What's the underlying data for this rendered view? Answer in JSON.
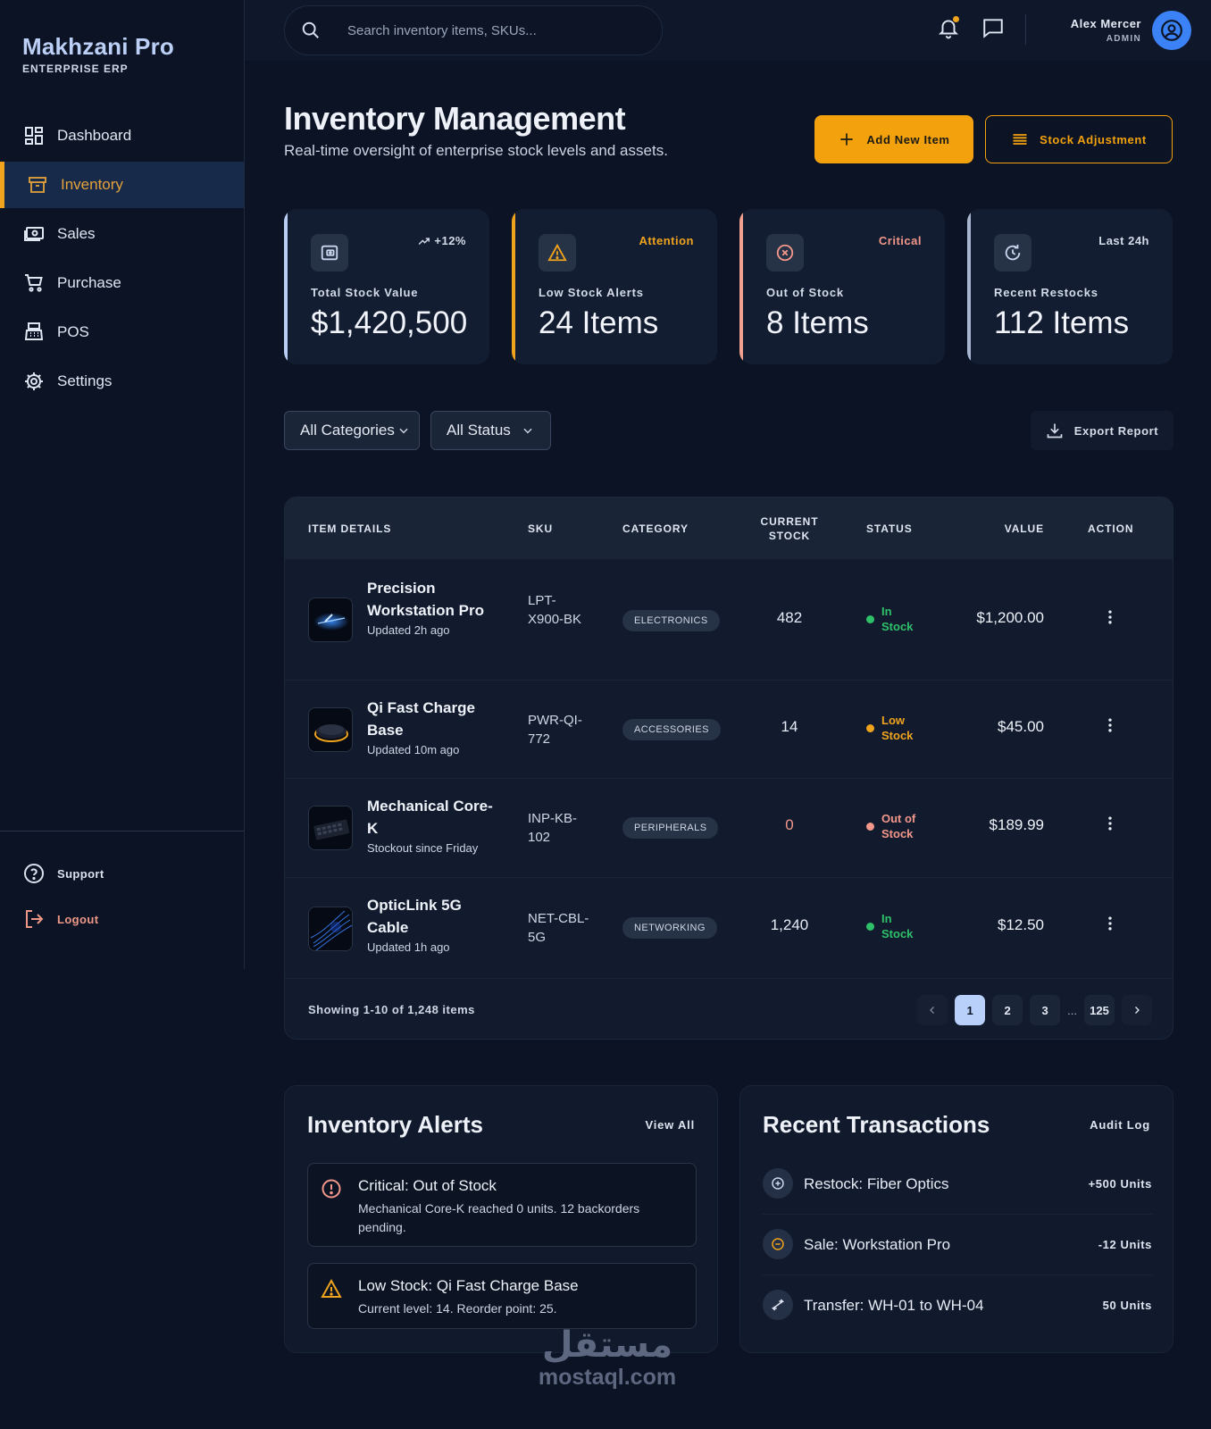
{
  "brand": {
    "name": "Makhzani Pro",
    "subtitle": "ENTERPRISE ERP"
  },
  "nav": {
    "items": [
      {
        "label": "Dashboard",
        "icon": "dashboard-icon",
        "active": false
      },
      {
        "label": "Inventory",
        "icon": "inventory-icon",
        "active": true
      },
      {
        "label": "Sales",
        "icon": "cash-icon",
        "active": false
      },
      {
        "label": "Purchase",
        "icon": "cart-icon",
        "active": false
      },
      {
        "label": "POS",
        "icon": "pos-icon",
        "active": false
      },
      {
        "label": "Settings",
        "icon": "gear-icon",
        "active": false
      }
    ],
    "support_label": "Support",
    "logout_label": "Logout"
  },
  "topbar": {
    "search_placeholder": "Search inventory items, SKUs...",
    "user_name": "Alex Mercer",
    "user_role": "ADMIN"
  },
  "header": {
    "title": "Inventory Management",
    "subtitle": "Real-time oversight of enterprise stock levels and assets.",
    "add_label": "Add New Item",
    "adjust_label": "Stock Adjustment"
  },
  "stats": [
    {
      "label": "Total Stock Value",
      "value": "$1,420,500",
      "tag": "+12%",
      "tag_color": "#d3dbe8",
      "icon": "wallet-icon",
      "icon_color": "#c9d6ee"
    },
    {
      "label": "Low Stock Alerts",
      "value": "24 Items",
      "tag": "Attention",
      "tag_color": "#f0a31c",
      "icon": "warning-icon",
      "icon_color": "#f0a31c"
    },
    {
      "label": "Out of Stock",
      "value": "8 Items",
      "tag": "Critical",
      "tag_color": "#f2978a",
      "icon": "x-circle-icon",
      "icon_color": "#f2978a"
    },
    {
      "label": "Recent Restocks",
      "value": "112 Items",
      "tag": "Last 24h",
      "tag_color": "#d3dbe8",
      "icon": "restock-icon",
      "icon_color": "#c9d6ee"
    }
  ],
  "filters": {
    "category": "All Categories",
    "status": "All Status",
    "export_label": "Export Report"
  },
  "table": {
    "headers": {
      "item": "ITEM DETAILS",
      "sku": "SKU",
      "category": "CATEGORY",
      "stock": "CURRENT STOCK",
      "status": "STATUS",
      "value": "VALUE",
      "action": "ACTION"
    },
    "rows": [
      {
        "name": "Precision Workstation Pro",
        "sub": "Updated 2h ago",
        "sku": "LPT-X900-BK",
        "category": "ELECTRONICS",
        "stock": "482",
        "status": "In Stock",
        "status_kind": "in",
        "value": "$1,200.00"
      },
      {
        "name": "Qi Fast Charge Base",
        "sub": "Updated 10m ago",
        "sku": "PWR-QI-772",
        "category": "ACCESSORIES",
        "stock": "14",
        "status": "Low Stock",
        "status_kind": "low",
        "value": "$45.00"
      },
      {
        "name": "Mechanical Core-K",
        "sub": "Stockout since Friday",
        "sku": "INP-KB-102",
        "category": "PERIPHERALS",
        "stock": "0",
        "status": "Out of Stock",
        "status_kind": "out",
        "value": "$189.99"
      },
      {
        "name": "OpticLink 5G Cable",
        "sub": "Updated 1h ago",
        "sku": "NET-CBL-5G",
        "category": "NETWORKING",
        "stock": "1,240",
        "status": "In Stock",
        "status_kind": "in",
        "value": "$12.50"
      }
    ],
    "showing": "Showing 1-10 of 1,248 items",
    "pages": [
      "1",
      "2",
      "3",
      "...",
      "125"
    ]
  },
  "alerts": {
    "title": "Inventory Alerts",
    "link": "View All",
    "items": [
      {
        "title": "Critical: Out of Stock",
        "desc": "Mechanical Core-K reached 0 units. 12 backorders pending.",
        "icon": "alert-circle-icon",
        "color": "#f2978a"
      },
      {
        "title": "Low Stock: Qi Fast Charge Base",
        "desc": "Current level: 14. Reorder point: 25.",
        "icon": "warning-icon",
        "color": "#f0a31c"
      }
    ]
  },
  "transactions": {
    "title": "Recent Transactions",
    "link": "Audit Log",
    "items": [
      {
        "label": "Restock: Fiber Optics",
        "qty": "+500 Units",
        "icon": "plus-circle-icon",
        "color": "#c9d6ee"
      },
      {
        "label": "Sale: Workstation Pro",
        "qty": "-12 Units",
        "icon": "minus-circle-icon",
        "color": "#f0a31c"
      },
      {
        "label": "Transfer: WH-01 to WH-04",
        "qty": "50 Units",
        "icon": "transfer-icon",
        "color": "#dfe6f1"
      }
    ]
  },
  "watermark": {
    "arabic": "مستقل",
    "latin": "mostaql.com"
  }
}
